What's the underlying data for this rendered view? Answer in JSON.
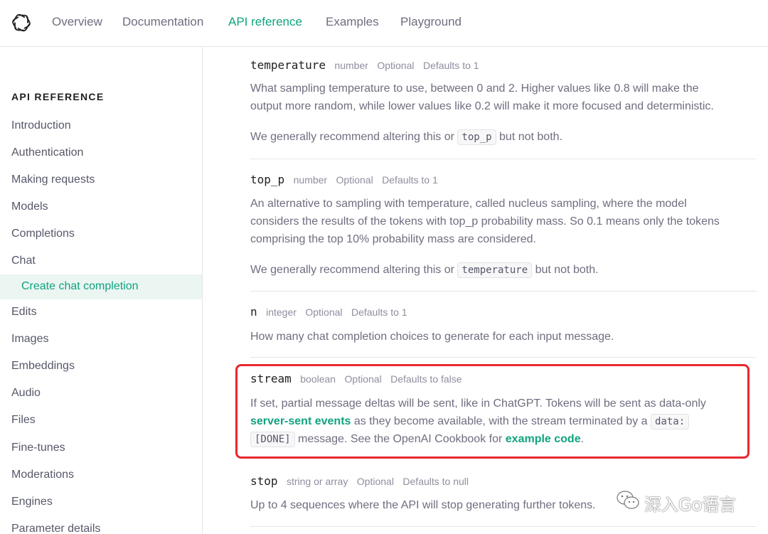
{
  "nav": {
    "logo": "openai-logo",
    "links": [
      "Overview",
      "Documentation",
      "API reference",
      "Examples",
      "Playground"
    ],
    "active": "API reference"
  },
  "sidebar": {
    "heading": "API REFERENCE",
    "items": [
      "Introduction",
      "Authentication",
      "Making requests",
      "Models",
      "Completions",
      "Chat"
    ],
    "active_item": "Create chat completion",
    "items_after": [
      "Edits",
      "Images",
      "Embeddings",
      "Audio",
      "Files",
      "Fine-tunes",
      "Moderations",
      "Engines",
      "Parameter details"
    ]
  },
  "params": {
    "temperature": {
      "name": "temperature",
      "type": "number",
      "optional": "Optional",
      "default": "Defaults to 1",
      "desc1": "What sampling temperature to use, between 0 and 2. Higher values like 0.8 will make the",
      "desc2": "output more random, while lower values like 0.2 will make it more focused and deterministic.",
      "rec_pre": "We generally recommend altering this or",
      "rec_code": "top_p",
      "rec_post": "but not both."
    },
    "top_p": {
      "name": "top_p",
      "type": "number",
      "optional": "Optional",
      "default": "Defaults to 1",
      "desc1": "An alternative to sampling with temperature, called nucleus sampling, where the model",
      "desc2": "considers the results of the tokens with top_p probability mass. So 0.1 means only the tokens",
      "desc3": "comprising the top 10% probability mass are considered.",
      "rec_pre": "We generally recommend altering this or",
      "rec_code": "temperature",
      "rec_post": "but not both."
    },
    "n": {
      "name": "n",
      "type": "integer",
      "optional": "Optional",
      "default": "Defaults to 1",
      "desc1": "How many chat completion choices to generate for each input message."
    },
    "stream": {
      "name": "stream",
      "type": "boolean",
      "optional": "Optional",
      "default": "Defaults to false",
      "line1": "If set, partial message deltas will be sent, like in ChatGPT. Tokens will be sent as data-only",
      "link1": "server-sent events",
      "line2_mid": "as they become available, with the stream terminated by a",
      "code1": "data:",
      "code2": "[DONE]",
      "line3_mid": "message. See the OpenAI Cookbook for",
      "link2": "example code",
      "line3_end": "."
    },
    "stop": {
      "name": "stop",
      "type": "string or array",
      "optional": "Optional",
      "default": "Defaults to null",
      "desc1": "Up to 4 sequences where the API will stop generating further tokens."
    }
  },
  "watermark": {
    "text": "深入Go语言",
    "icon": "wechat-icon"
  },
  "colors": {
    "accent": "#10a37f",
    "highlight_border": "#e8282f",
    "active_bg": "#ebf5f2"
  }
}
